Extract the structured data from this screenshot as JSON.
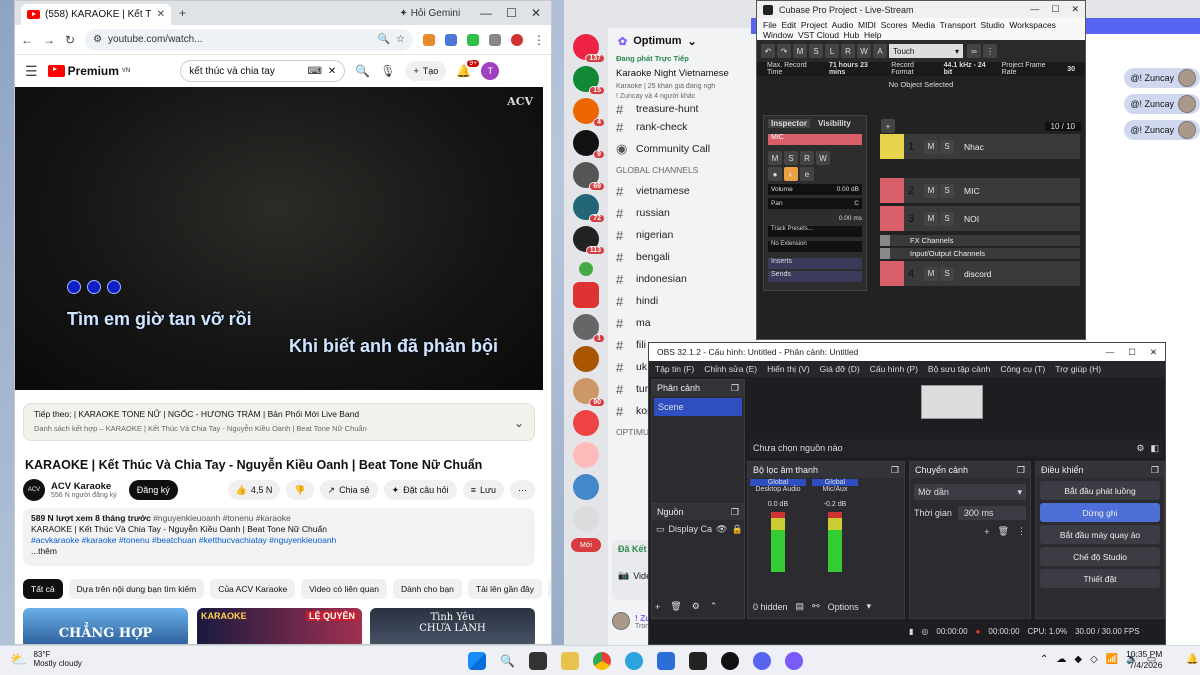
{
  "chrome": {
    "tab_title": "(558) KARAOKE | Kết Thúc V",
    "gemini": "Hỏi Gemini",
    "url": "youtube.com/watch...",
    "yt_brand": "Premium",
    "yt_region": "VN",
    "search_query": "kết thúc và chia tay",
    "create_label": "Tạo",
    "notif_count": "9+",
    "avatar_letter": "T",
    "video_logo": "ACV",
    "lyric1": "Tìm em giờ tan vỡ rồi",
    "lyric2": "Khi biết anh đã phản bội",
    "next_up": "Tiếp theo: | KARAOKE TONE NỮ | NGỐC - HƯƠNG TRÀM | Bản Phối Mới Live Band",
    "next_up_sub": "Danh sách kết hợp – KARAOKE | Kết Thúc Và Chia Tay - Nguyễn Kiều Oanh | Beat Tone Nữ Chuẩn",
    "video_title": "KARAOKE | Kết Thúc Và Chia Tay - Nguyễn Kiều Oanh | Beat Tone Nữ Chuẩn",
    "channel_name": "ACV Karaoke",
    "channel_subs": "556 N người đăng ký",
    "subscribe": "Đăng ký",
    "likes": "4,5 N",
    "share": "Chia sẻ",
    "thanks": "Đặt câu hỏi",
    "save": "Lưu",
    "desc_meta": "589 N lượt xem  8 tháng trước",
    "desc_tags1": "#nguyenkieuoanh #tonenu #karaoke",
    "desc_line2": "KARAOKE | Kết Thúc Và Chia Tay - Nguyễn Kiều Oanh  | Beat Tone Nữ Chuẩn",
    "desc_tags2": "#acvkaraoke #karaoke #tonenu  #beatchuan #ketthucvachiatay #nguyenkieuoanh",
    "desc_more": "...thêm",
    "cats": [
      "Tất cả",
      "Dựa trên nội dung bạn tìm kiếm",
      "Của ACV Karaoke",
      "Video có liên quan",
      "Dành cho bạn",
      "Tải lên gần đây",
      "Đ"
    ],
    "thumb1": "CHẲNG HỢP",
    "thumb2a": "KARAOKE",
    "thumb2b": "LỆ QUYÊN",
    "thumb3": "Tình Yêu\nCHƯA LÀNH"
  },
  "discord": {
    "server_name": "Optimum",
    "live_label": "Đang phát Trực Tiếp",
    "stage_title": "Karaoke Night Vietnamese",
    "stage_meta": "Karaoke  |  25 khán giả đang ngh",
    "stage_users": "! Zuncay và 4 người khác",
    "channels_top": [
      "treasure-hunt",
      "rank-check"
    ],
    "community_call": "Community Call",
    "global_cat": "GLOBAL CHANNELS",
    "global": [
      "vietnamese",
      "russian",
      "nigerian",
      "bengali",
      "indonesian",
      "hindi",
      "ma",
      "fili",
      "uk",
      "tur",
      "kor"
    ],
    "optimum_cat": "OPTIMUM",
    "badges": [
      "137",
      "15",
      "4",
      "9",
      "69",
      "72",
      "113",
      "1",
      "90"
    ],
    "new_label": "Mới",
    "voice_connected": "Đã Kết Nối",
    "video_label": "Video",
    "user_name": "! Zuncay",
    "user_status": "Trong một sư",
    "zuncay": "@! Zuncay"
  },
  "cubase": {
    "title": "Cubase Pro Project - Live-Stream",
    "menu": [
      "File",
      "Edit",
      "Project",
      "Audio",
      "MIDI",
      "Scores",
      "Media",
      "Transport",
      "Studio",
      "Workspaces",
      "Window",
      "VST Cloud",
      "Hub",
      "Help"
    ],
    "mode": "Touch",
    "max_rec_lbl": "Max. Record Time",
    "max_rec": "71 hours 23 mins",
    "rec_fmt_lbl": "Record Format",
    "rec_fmt": "44.1 kHz - 24 bit",
    "frame_lbl": "Project Frame Rate",
    "frame": "30",
    "no_obj": "No Object Selected",
    "inspector": "Inspector",
    "visibility": "Visibility",
    "track_sel": "MIC",
    "volume_lbl": "Volume",
    "volume": "0.00 dB",
    "pan_lbl": "Pan",
    "pan": "C",
    "delay": "0.00 ms",
    "presets": "Track Presets...",
    "noext": "No Extension",
    "inserts": "Inserts",
    "sends": "Sends",
    "count": "10 / 10",
    "tracks": [
      {
        "num": "1",
        "name": "Nhac",
        "color": "#e8d44a"
      },
      {
        "num": "2",
        "name": "MIC",
        "color": "#d9606a"
      },
      {
        "num": "3",
        "name": "NOI",
        "color": "#d9606a"
      },
      {
        "num": "",
        "name": "FX Channels",
        "color": "#888"
      },
      {
        "num": "",
        "name": "Input/Output Channels",
        "color": "#888"
      },
      {
        "num": "4",
        "name": "discord",
        "color": "#d9606a"
      }
    ]
  },
  "obs": {
    "title": "OBS 32.1.2 - Cấu hình: Untitled - Phân cảnh: Untitled",
    "menu": [
      "Tập tin (F)",
      "Chỉnh sửa (E)",
      "Hiển thị (V)",
      "Giá đỡ (D)",
      "Cấu hình (P)",
      "Bộ sưu tập cảnh",
      "Công cụ (T)",
      "Trợ giúp (H)"
    ],
    "scenes_h": "Phân cảnh",
    "scene": "Scene",
    "no_source": "Chưa chọn nguồn nào",
    "mixer_h": "Bộ lọc âm thanh",
    "global": "Global",
    "desktop_audio": "Desktop Audio",
    "mic_aux": "Mic/Aux",
    "db1": "0.0 dB",
    "db2": "-0.2 dB",
    "sources_h": "Nguồn",
    "source1": "Display Ca",
    "hidden": "0 hidden",
    "options": "Options",
    "trans_h": "Chuyển cảnh",
    "trans": "Mờ dần",
    "dur_lbl": "Thời gian",
    "dur": "300 ms",
    "ctrl_h": "Điều khiển",
    "btn_stream": "Bắt đầu phát luồng",
    "btn_rec": "Dừng ghi",
    "btn_vcam": "Bắt đầu máy quay ảo",
    "btn_studio": "Chế độ Studio",
    "btn_settings": "Thiết đặt",
    "stat_t1": "00:00:00",
    "stat_t2": "00:00:00",
    "cpu": "CPU: 1.0%",
    "fps": "30.00 / 30.00 FPS"
  },
  "taskbar": {
    "temp": "83°F",
    "weather": "Mostly cloudy",
    "time": "10:35 PM",
    "date": "7/4/2026"
  }
}
